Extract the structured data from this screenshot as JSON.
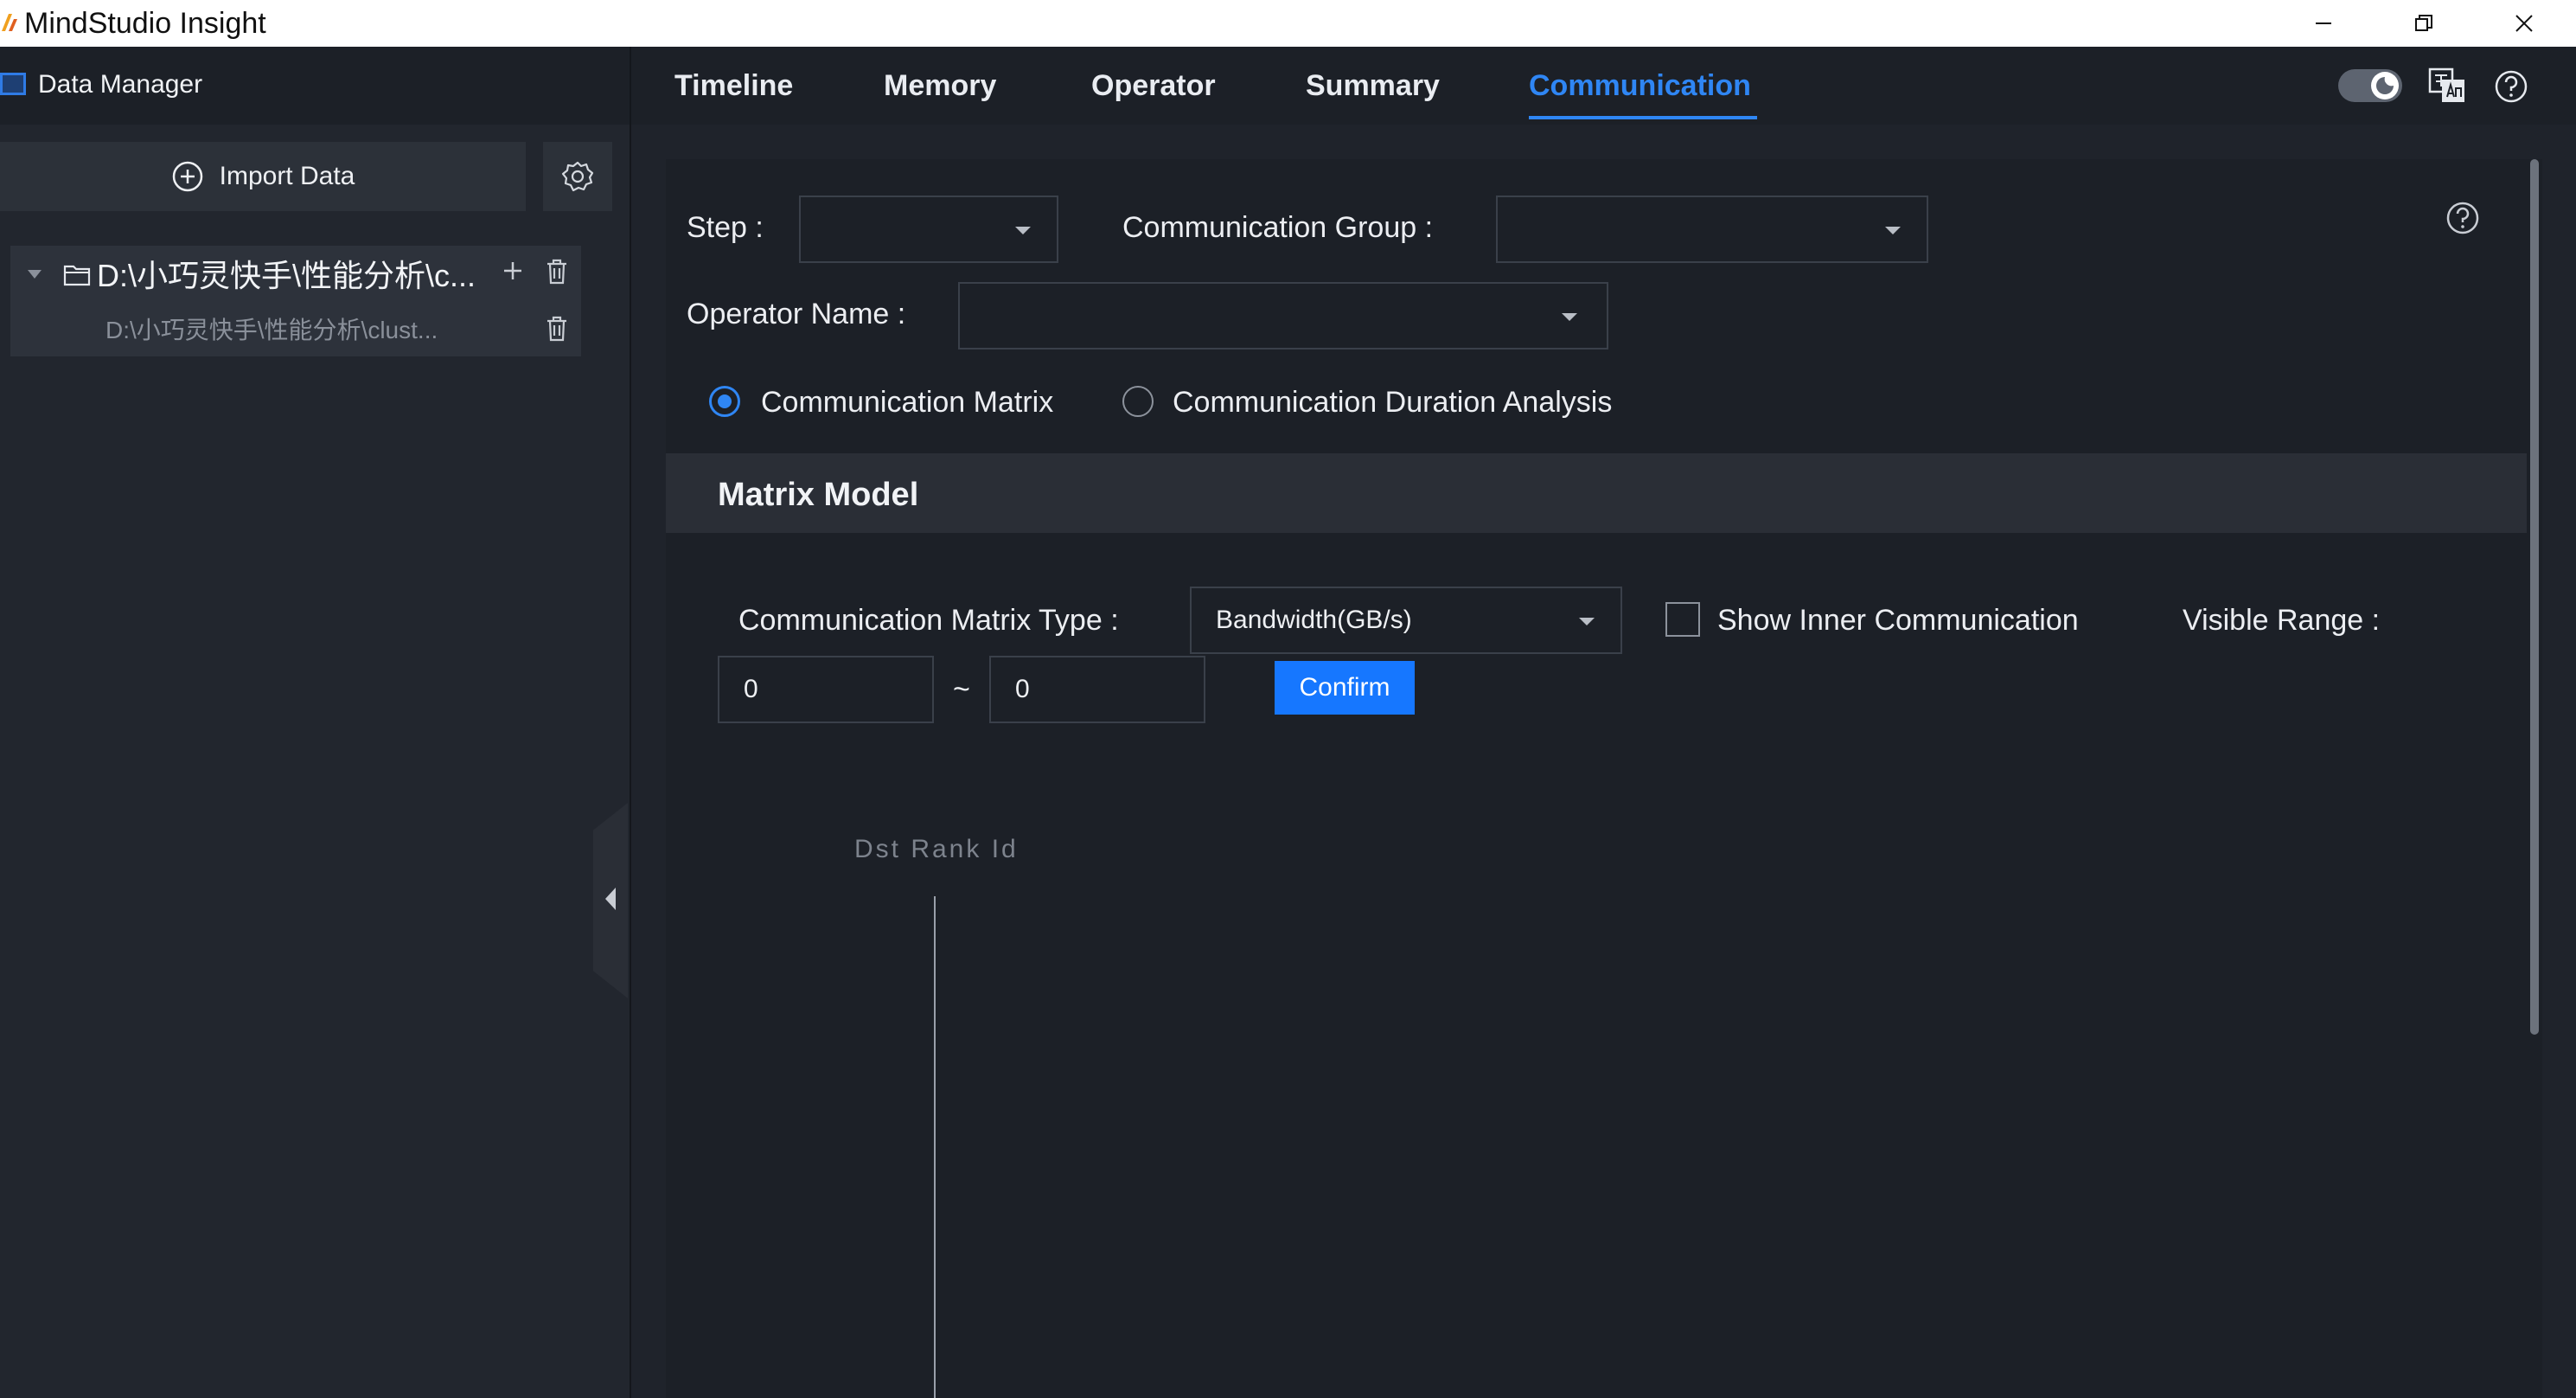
{
  "window": {
    "title": "MindStudio Insight"
  },
  "left_panel": {
    "title": "Data Manager",
    "import_label": "Import Data",
    "tree": {
      "root_label": "D:\\小巧灵快手\\性能分析\\c...",
      "child_label": "D:\\小巧灵快手\\性能分析\\clust..."
    }
  },
  "tabs": [
    {
      "label": "Timeline"
    },
    {
      "label": "Memory"
    },
    {
      "label": "Operator"
    },
    {
      "label": "Summary"
    },
    {
      "label": "Communication",
      "active": true
    }
  ],
  "filters": {
    "step_label": "Step :",
    "step_value": "",
    "group_label": "Communication Group :",
    "group_value": "",
    "operator_label": "Operator Name :",
    "operator_value": ""
  },
  "analysis_modes": [
    {
      "label": "Communication Matrix",
      "selected": true
    },
    {
      "label": "Communication Duration Analysis",
      "selected": false
    }
  ],
  "matrix": {
    "title": "Matrix Model",
    "type_label": "Communication Matrix Type :",
    "type_value": "Bandwidth(GB/s)",
    "inner_label": "Show Inner Communication",
    "inner_checked": false,
    "range_label": "Visible Range :",
    "range_min": "0",
    "range_sep": "~",
    "range_max": "0",
    "confirm_label": "Confirm",
    "axis_label": "Dst Rank Id"
  },
  "colors": {
    "accent": "#2f86f4",
    "button": "#1677ff",
    "background": "#1f232b"
  },
  "icons": [
    "app-logo",
    "minimize-icon",
    "restore-icon",
    "close-icon",
    "data-manager-icon",
    "add-circle-icon",
    "gear-icon",
    "chevron-down-icon",
    "folder-icon",
    "plus-icon",
    "trash-icon",
    "theme-toggle-icon",
    "language-icon",
    "help-icon",
    "collapse-icon"
  ]
}
